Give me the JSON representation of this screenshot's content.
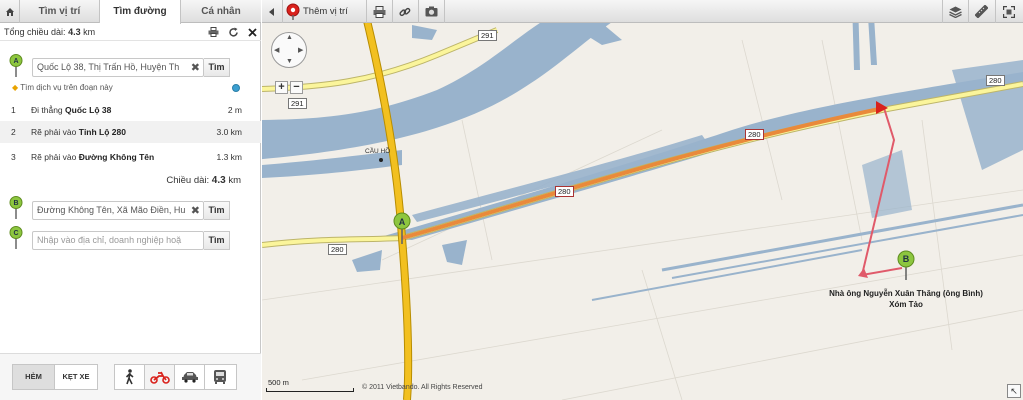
{
  "tabs": {
    "home_icon": "home-icon",
    "items": [
      {
        "label": "Tìm vị trí"
      },
      {
        "label": "Tìm đường"
      },
      {
        "label": "Cá nhân"
      }
    ]
  },
  "route": {
    "total_top_label": "Tổng chiều dài:",
    "total_top_value": "4.3",
    "total_top_unit": "km",
    "origin": {
      "marker": "A",
      "value": "Quốc Lộ 38, Thị Trấn Hồ, Huyện Th",
      "button": "Tìm"
    },
    "service_link": "Tìm dịch vụ trên đoạn này",
    "steps": [
      {
        "num": "1",
        "prefix": "Đi thẳng",
        "road": "Quốc Lộ 38",
        "dist": "2 m"
      },
      {
        "num": "2",
        "prefix": "Rẽ phải vào",
        "road": "Tỉnh Lộ 280",
        "dist": "3.0 km"
      },
      {
        "num": "3",
        "prefix": "Rẽ phải vào",
        "road": "Đường Không Tên",
        "dist": "1.3 km"
      }
    ],
    "total_label": "Chiều dài:",
    "total_value": "4.3",
    "total_unit": "km",
    "destination": {
      "marker": "B",
      "value": "Đường Không Tên, Xã Mão Điền, Hu",
      "button": "Tìm"
    },
    "extra_stop": {
      "marker": "C",
      "placeholder": "Nhập vào địa chỉ, doanh nghiệp hoặ",
      "button": "Tìm"
    }
  },
  "bottom": {
    "modes": [
      {
        "label": "HẺM",
        "active": true
      },
      {
        "label": "KẸT XE",
        "active": false
      }
    ],
    "vehicles": [
      "walk-icon",
      "motorbike-icon",
      "car-icon",
      "bus-icon"
    ]
  },
  "map_toolbar": {
    "add_location": "Thêm vị trí",
    "icons": [
      "collapse-arrow-icon",
      "map-pin-icon",
      "print-icon",
      "link-icon",
      "camera-icon",
      "layers-icon",
      "ruler-icon",
      "fullscreen-icon"
    ]
  },
  "map": {
    "road_labels": [
      "291",
      "291",
      "280",
      "280",
      "280",
      "280"
    ],
    "place_label": "CẦU HỒ",
    "marker_a": "A",
    "marker_b": "B",
    "destination_label_line1": "Nhà ông Nguyễn Xuân Thăng (ông Bình)",
    "destination_label_line2": "Xóm Tảo",
    "scale": "500 m",
    "copyright": "© 2011 Vietbando. All Rights Reserved",
    "colors": {
      "land": "#f2efe9",
      "water": "#99b3cc",
      "national_road": "#f2c020",
      "provincial_road": "#fbf59b",
      "route_line": "#e98a3b",
      "marker_green": "#8dc63f",
      "walk_line": "#e05a6a"
    }
  }
}
